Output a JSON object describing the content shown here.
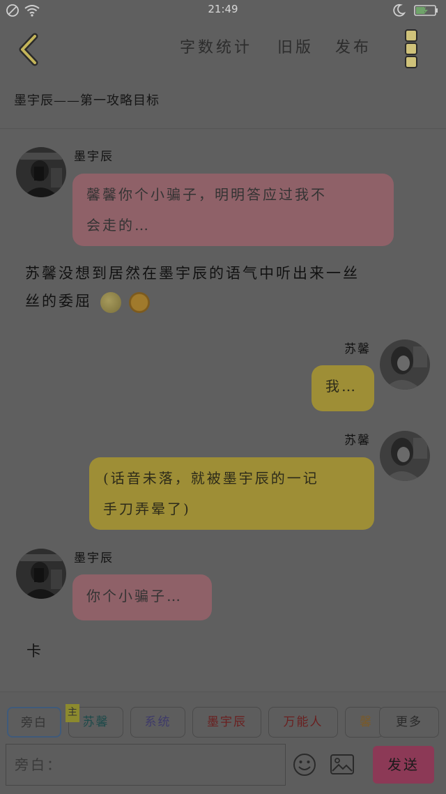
{
  "status_bar": {
    "time": "21:49",
    "icons": [
      "do-not-disturb-icon",
      "wifi-icon",
      "moon-icon",
      "battery-charging-icon"
    ]
  },
  "toolbar": {
    "back_icon": "chevron-left-icon",
    "word_count_label": "字数统计",
    "old_version_label": "旧版",
    "publish_label": "发布",
    "more_icon": "vertical-dots-icon"
  },
  "story": {
    "title": "墨宇辰——第一攻略目标"
  },
  "messages": [
    {
      "type": "bubble",
      "side": "left",
      "speaker": "墨宇辰",
      "lines": [
        "馨馨你个小骗子，明明答应过我不",
        "会走的…"
      ],
      "color": "pink"
    },
    {
      "type": "narration",
      "lines": [
        "苏馨没想到居然在墨宇辰的语气中听出来一丝",
        "丝的委屈"
      ],
      "emojis": [
        "moon-face-icon",
        "sun-face-icon"
      ]
    },
    {
      "type": "bubble",
      "side": "right",
      "speaker": "苏馨",
      "lines": [
        "我…"
      ],
      "color": "yellow"
    },
    {
      "type": "bubble",
      "side": "right",
      "speaker": "苏馨",
      "lines": [
        "(话音未落，就被墨宇辰的一记",
        "手刀弄晕了)"
      ],
      "color": "yellow"
    },
    {
      "type": "bubble",
      "side": "left",
      "speaker": "墨宇辰",
      "lines": [
        "你个小骗子…"
      ],
      "color": "pink"
    },
    {
      "type": "narration",
      "lines": [
        "卡"
      ]
    }
  ],
  "roles": {
    "tabs": [
      "旁白",
      "苏馨",
      "系统",
      "墨宇辰",
      "万能人",
      "馨",
      "更多"
    ],
    "main_badge": "主",
    "selected": "旁白"
  },
  "composer": {
    "placeholder": "旁白：",
    "emoji_icon": "smiley-icon",
    "image_icon": "image-icon",
    "send_label": "发送"
  },
  "colors": {
    "background": "#5f5f5f",
    "pink_bubble": "#8f6168",
    "yellow_bubble": "#9e8e36",
    "send_button": "#8c3956",
    "more_dots": "#cfc27a"
  }
}
